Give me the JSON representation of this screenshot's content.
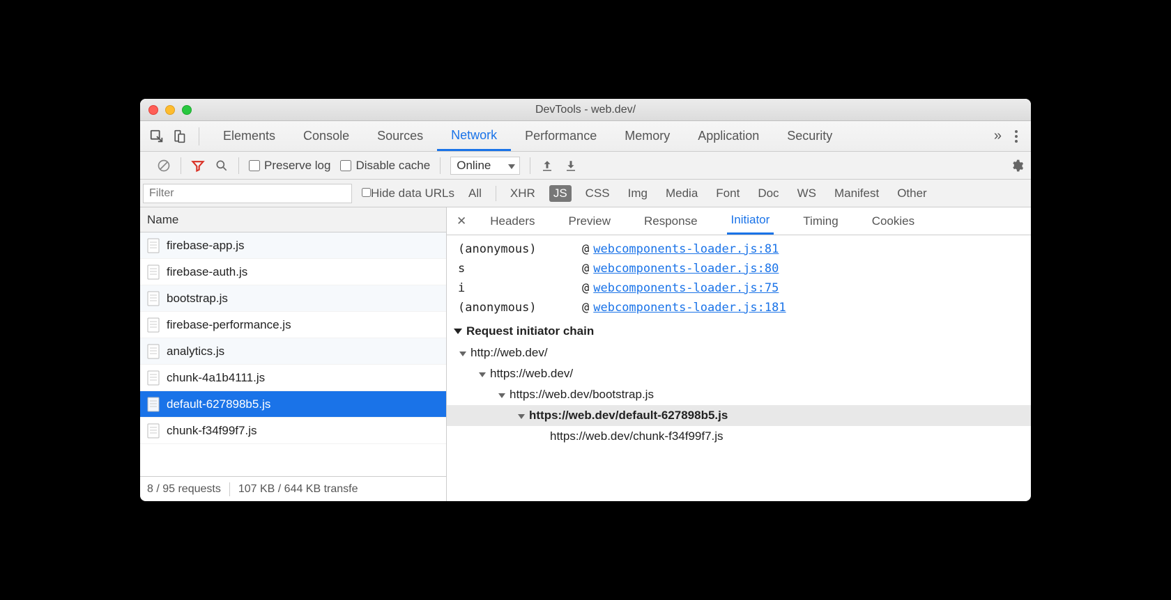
{
  "window": {
    "title": "DevTools - web.dev/"
  },
  "mainTabs": [
    "Elements",
    "Console",
    "Sources",
    "Network",
    "Performance",
    "Memory",
    "Application",
    "Security"
  ],
  "mainTabActive": "Network",
  "netToolbar": {
    "preserve": "Preserve log",
    "disableCache": "Disable cache",
    "throttle": "Online"
  },
  "filterRow": {
    "placeholder": "Filter",
    "hideData": "Hide data URLs",
    "types": [
      "All",
      "XHR",
      "JS",
      "CSS",
      "Img",
      "Media",
      "Font",
      "Doc",
      "WS",
      "Manifest",
      "Other"
    ],
    "typeSelected": "JS"
  },
  "requests": {
    "header": "Name",
    "selected": "default-627898b5.js",
    "items": [
      "firebase-app.js",
      "firebase-auth.js",
      "bootstrap.js",
      "firebase-performance.js",
      "analytics.js",
      "chunk-4a1b4111.js",
      "default-627898b5.js",
      "chunk-f34f99f7.js"
    ]
  },
  "status": {
    "requests": "8 / 95 requests",
    "transfer": "107 KB / 644 KB transfe"
  },
  "subTabs": [
    "Headers",
    "Preview",
    "Response",
    "Initiator",
    "Timing",
    "Cookies"
  ],
  "subTabActive": "Initiator",
  "stack": [
    {
      "fn": "(anonymous)",
      "link": "webcomponents-loader.js:81"
    },
    {
      "fn": "s",
      "link": "webcomponents-loader.js:80"
    },
    {
      "fn": "i",
      "link": "webcomponents-loader.js:75"
    },
    {
      "fn": "(anonymous)",
      "link": "webcomponents-loader.js:181"
    }
  ],
  "chain": {
    "title": "Request initiator chain",
    "rows": [
      {
        "indent": 0,
        "arrow": true,
        "text": "http://web.dev/",
        "current": false
      },
      {
        "indent": 1,
        "arrow": true,
        "text": "https://web.dev/",
        "current": false
      },
      {
        "indent": 2,
        "arrow": true,
        "text": "https://web.dev/bootstrap.js",
        "current": false
      },
      {
        "indent": 3,
        "arrow": true,
        "text": "https://web.dev/default-627898b5.js",
        "current": true
      },
      {
        "indent": 4,
        "arrow": false,
        "text": "https://web.dev/chunk-f34f99f7.js",
        "current": false
      }
    ]
  }
}
